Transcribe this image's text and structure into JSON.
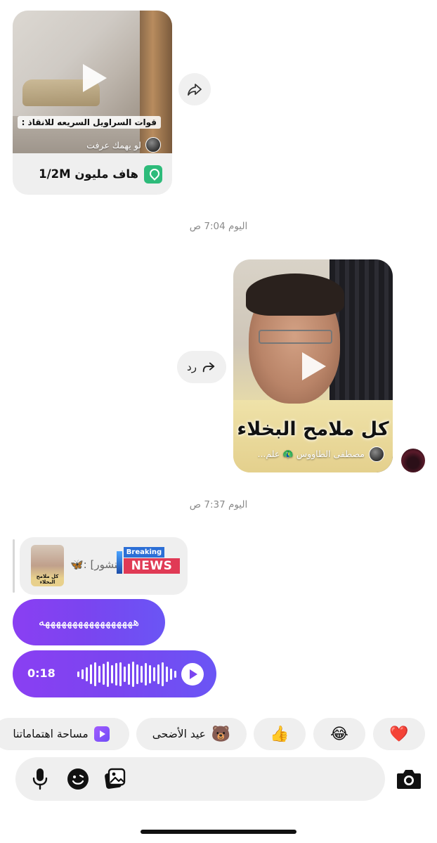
{
  "shared_reel_1": {
    "caption": "قوات السراويل السريعه للانقاذ :",
    "author": "لو يهمك عرفت",
    "location_label": "هاف مليون 1/2M"
  },
  "timestamps": [
    "اليوم 7:04 ص",
    "اليوم 7:37 ص"
  ],
  "shared_reel_2": {
    "overlay_title": "كل ملامح البخلاء",
    "author": "مصطفى الطاووس 🦚 علم..."
  },
  "reply_button": {
    "label": "رد"
  },
  "quoted_post": {
    "text": "🦋: [منشور]",
    "thumb_label": "كل ملامح البخلاء",
    "badge_top": "Breaking",
    "badge_bottom": "NEWS"
  },
  "text_message": {
    "text": "هههههههههههههههههه"
  },
  "voice_message": {
    "duration": "0:18"
  },
  "quick_chips": [
    {
      "emoji": "❤️"
    },
    {
      "emoji": "😂"
    },
    {
      "emoji": "👍"
    },
    {
      "emoji": "🐻",
      "label": "عيد الأضحى"
    },
    {
      "label": "مساحة اهتماماتنا"
    }
  ],
  "icons": [
    "share-icon",
    "reply-icon",
    "mic-icon",
    "sticker-icon",
    "gallery-icon",
    "camera-icon",
    "play-icon",
    "location-icon"
  ],
  "colors": {
    "accent_purple": "#7a45f0",
    "bubble_gray": "#efefef",
    "location_green": "#2dbb7a"
  }
}
